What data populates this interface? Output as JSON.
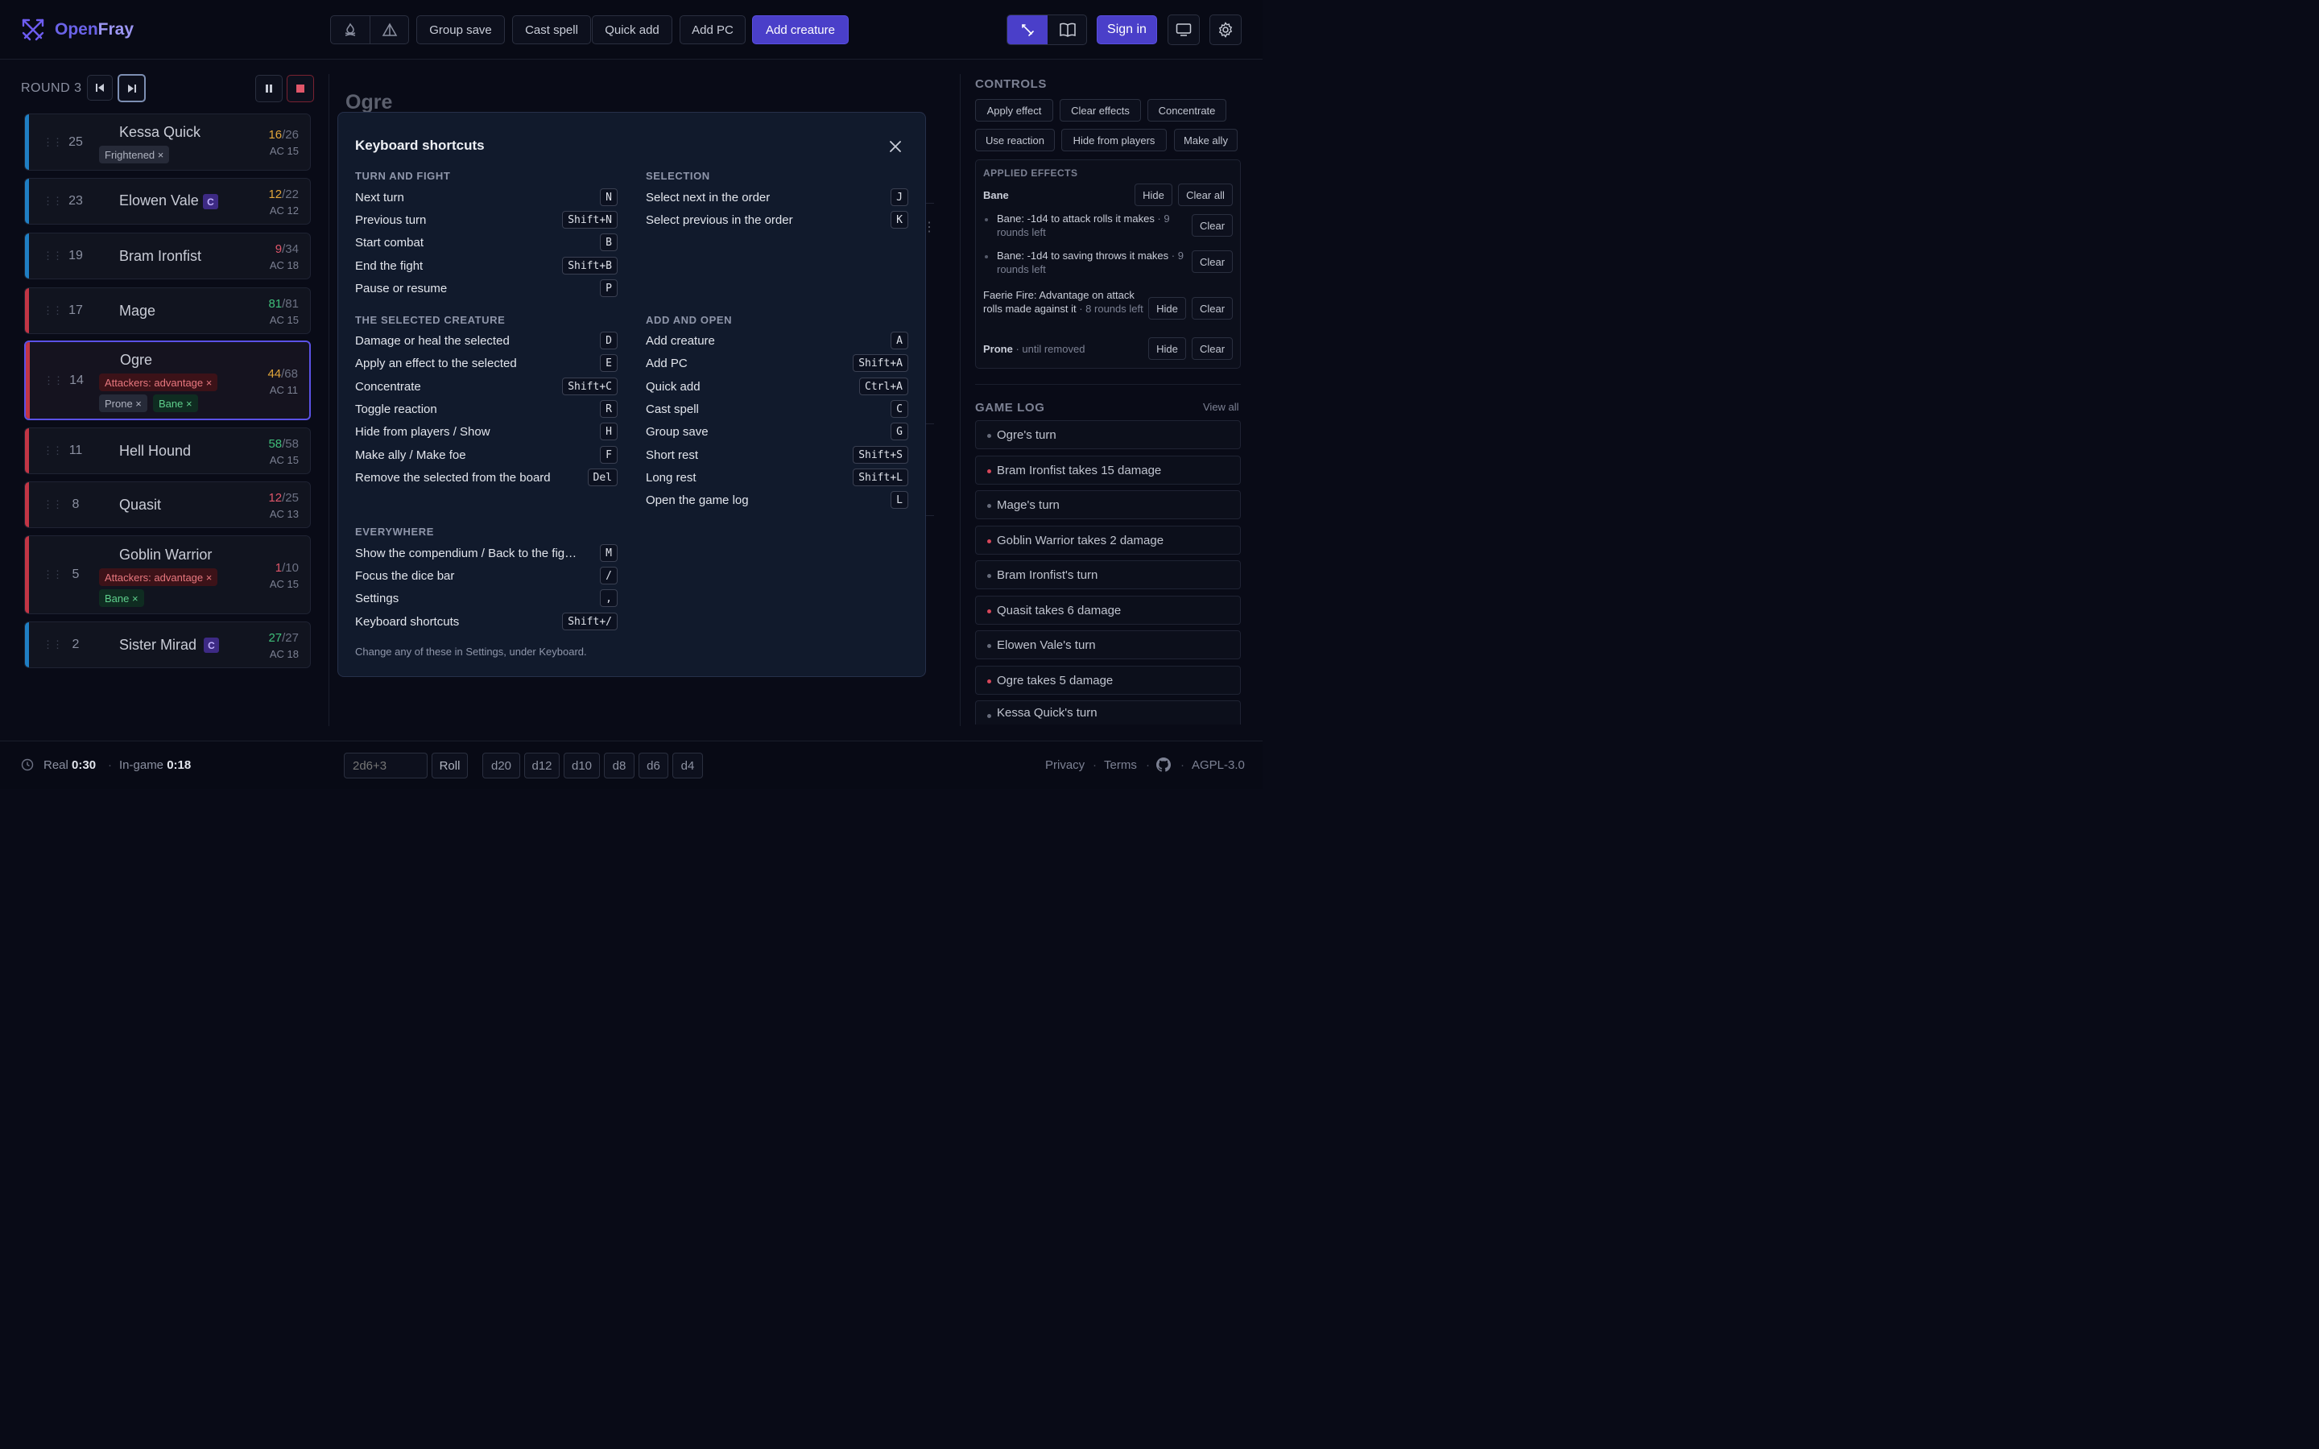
{
  "header": {
    "brand_open": "Open",
    "brand_fray": "Fray",
    "group_save": "Group save",
    "cast_spell": "Cast spell",
    "quick_add": "Quick add",
    "add_pc": "Add PC",
    "add_creature": "Add creature",
    "sign_in": "Sign in"
  },
  "tracker": {
    "round_label": "ROUND 3",
    "combatants": [
      {
        "init": "25",
        "name": "Kessa Quick",
        "hp": "16",
        "max": "/26",
        "ac": "AC 15",
        "tags": [
          "Frightened ×"
        ]
      },
      {
        "init": "23",
        "name": "Elowen Vale",
        "badge": "C",
        "hp": "12",
        "max": "/22",
        "ac": "AC 12"
      },
      {
        "init": "19",
        "name": "Bram Ironfist",
        "hp": "9",
        "max": "/34",
        "ac": "AC 18"
      },
      {
        "init": "17",
        "name": "Mage",
        "hp": "81",
        "max": "/81",
        "ac": "AC 15"
      },
      {
        "init": "14",
        "name": "Ogre",
        "hp": "44",
        "max": "/68",
        "ac": "AC 11",
        "tags": [
          "Attackers: advantage ×",
          "Prone ×",
          "Bane ×"
        ]
      },
      {
        "init": "11",
        "name": "Hell Hound",
        "hp": "58",
        "max": "/58",
        "ac": "AC 15"
      },
      {
        "init": "8",
        "name": "Quasit",
        "hp": "12",
        "max": "/25",
        "ac": "AC 13"
      },
      {
        "init": "5",
        "name": "Goblin Warrior",
        "hp": "1",
        "max": "/10",
        "ac": "AC 15",
        "tags": [
          "Attackers: advantage ×",
          "Bane ×"
        ]
      },
      {
        "init": "2",
        "name": "Sister Mirad",
        "badge": "C",
        "hp": "27",
        "max": "/27",
        "ac": "AC 18"
      }
    ]
  },
  "main": {
    "title": "Ogre"
  },
  "modal": {
    "title": "Keyboard shortcuts",
    "footer": "Change any of these in Settings, under Keyboard.",
    "sections": {
      "turn": {
        "title": "TURN AND FIGHT",
        "items": [
          {
            "label": "Next turn",
            "key": "N"
          },
          {
            "label": "Previous turn",
            "key": "Shift+N"
          },
          {
            "label": "Start combat",
            "key": "B"
          },
          {
            "label": "End the fight",
            "key": "Shift+B"
          },
          {
            "label": "Pause or resume",
            "key": "P"
          }
        ]
      },
      "selection": {
        "title": "SELECTION",
        "items": [
          {
            "label": "Select next in the order",
            "key": "J"
          },
          {
            "label": "Select previous in the order",
            "key": "K"
          }
        ]
      },
      "selected": {
        "title": "THE SELECTED CREATURE",
        "items": [
          {
            "label": "Damage or heal the selected",
            "key": "D"
          },
          {
            "label": "Apply an effect to the selected",
            "key": "E"
          },
          {
            "label": "Concentrate",
            "key": "Shift+C"
          },
          {
            "label": "Toggle reaction",
            "key": "R"
          },
          {
            "label": "Hide from players / Show",
            "key": "H"
          },
          {
            "label": "Make ally / Make foe",
            "key": "F"
          },
          {
            "label": "Remove the selected from the board",
            "key": "Del"
          }
        ]
      },
      "add": {
        "title": "ADD AND OPEN",
        "items": [
          {
            "label": "Add creature",
            "key": "A"
          },
          {
            "label": "Add PC",
            "key": "Shift+A"
          },
          {
            "label": "Quick add",
            "key": "Ctrl+A"
          },
          {
            "label": "Cast spell",
            "key": "C"
          },
          {
            "label": "Group save",
            "key": "G"
          },
          {
            "label": "Short rest",
            "key": "Shift+S"
          },
          {
            "label": "Long rest",
            "key": "Shift+L"
          },
          {
            "label": "Open the game log",
            "key": "L"
          }
        ]
      },
      "everywhere": {
        "title": "EVERYWHERE",
        "items": [
          {
            "label": "Show the compendium / Back to the fig…",
            "key": "M"
          },
          {
            "label": "Focus the dice bar",
            "key": "/"
          },
          {
            "label": "Settings",
            "key": ","
          },
          {
            "label": "Keyboard shortcuts",
            "key": "Shift+/"
          }
        ]
      }
    }
  },
  "controls": {
    "title": "CONTROLS",
    "buttons": [
      "Apply effect",
      "Clear effects",
      "Concentrate",
      "Use reaction",
      "Hide from players",
      "Make ally"
    ],
    "effects_title": "APPLIED EFFECTS",
    "bane_name": "Bane",
    "hide": "Hide",
    "clear_all": "Clear all",
    "clear": "Clear",
    "bane_1": "Bane: -1d4 to attack rolls it makes",
    "bane_1_meta": " · 9 rounds left",
    "bane_2": "Bane: -1d4 to saving throws it makes",
    "bane_2_meta": " · 9 rounds left",
    "faerie": "Faerie Fire: Advantage on attack rolls made against it",
    "faerie_meta": " · 8 rounds left",
    "prone": "Prone",
    "prone_meta": " · until removed"
  },
  "log": {
    "title": "GAME LOG",
    "view_all": "View all",
    "items": [
      {
        "text": "Ogre's turn",
        "kind": "turn"
      },
      {
        "text": "Bram Ironfist takes 15 damage",
        "kind": "damage"
      },
      {
        "text": "Mage's turn",
        "kind": "turn"
      },
      {
        "text": "Goblin Warrior takes 2 damage",
        "kind": "damage"
      },
      {
        "text": "Bram Ironfist's turn",
        "kind": "turn"
      },
      {
        "text": "Quasit takes 6 damage",
        "kind": "damage"
      },
      {
        "text": "Elowen Vale's turn",
        "kind": "turn"
      },
      {
        "text": "Ogre takes 5 damage",
        "kind": "damage"
      },
      {
        "text": "Kessa Quick's turn",
        "kind": "turn"
      }
    ]
  },
  "footer": {
    "real_label": "Real",
    "real_time": "0:30",
    "ingame_label": "In-game",
    "ingame_time": "0:18",
    "dice_placeholder": "2d6+3",
    "roll": "Roll",
    "dice": [
      "d20",
      "d12",
      "d10",
      "d8",
      "d6",
      "d4"
    ],
    "privacy": "Privacy",
    "terms": "Terms",
    "license": "AGPL-3.0"
  },
  "colors": {
    "accent": "#4a3fc9",
    "hp_orange": "#e0a53a",
    "hp_red": "#e0566a",
    "hp_green": "#3fbf7a",
    "pc_bar": "#1f7fc4",
    "foe_bar": "#c23545"
  }
}
